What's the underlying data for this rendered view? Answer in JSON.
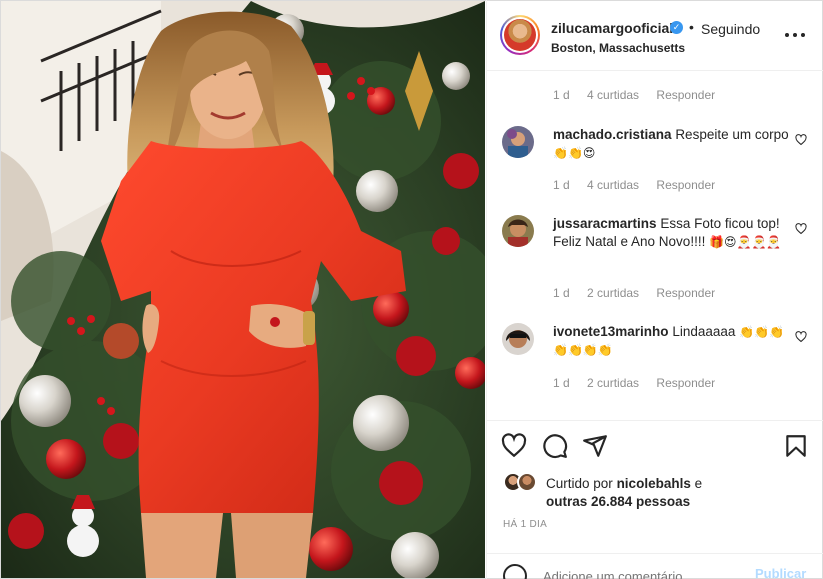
{
  "post": {
    "username": "zilucamargooficial",
    "separator": "•",
    "follow_status": "Seguindo",
    "location": "Boston, Massachusetts"
  },
  "comments": [
    {
      "id": "partial",
      "time": "1 d",
      "likes": "4 curtidas",
      "reply": "Responder"
    },
    {
      "username": "machado.cristiana",
      "text": "Respeite um corpo",
      "emoji": "👏👏😍",
      "time": "1 d",
      "likes": "4 curtidas",
      "reply": "Responder"
    },
    {
      "username": "jussaracmartins",
      "text": "Essa Foto ficou top! Feliz Natal e Ano Novo!!!!",
      "emoji": "🎁😍🎅🎅🎅",
      "time": "1 d",
      "likes": "2 curtidas",
      "reply": "Responder"
    },
    {
      "username": "ivonete13marinho",
      "text": "Lindaaaaa",
      "emoji": "👏👏👏👏👏👏👏",
      "time": "1 d",
      "likes": "2 curtidas",
      "reply": "Responder"
    }
  ],
  "likes": {
    "prefix": "Curtido por",
    "user": "nicolebahls",
    "suffix": "e",
    "others": "outras 26.884 pessoas"
  },
  "timestamp": "HÁ 1 DIA",
  "add_comment": {
    "placeholder": "Adicione um comentário...",
    "post_label": "Publicar"
  },
  "icons": {
    "like": "heart-icon",
    "comment": "comment-icon",
    "share": "share-icon",
    "save": "bookmark-icon",
    "more": "more-options-icon",
    "verified": "verified-badge-icon"
  },
  "colors": {
    "verified_blue": "#3897f0",
    "muted_text": "#8e8e8e",
    "dress_red": "#e8321f",
    "post_button": "#b3dbff"
  }
}
